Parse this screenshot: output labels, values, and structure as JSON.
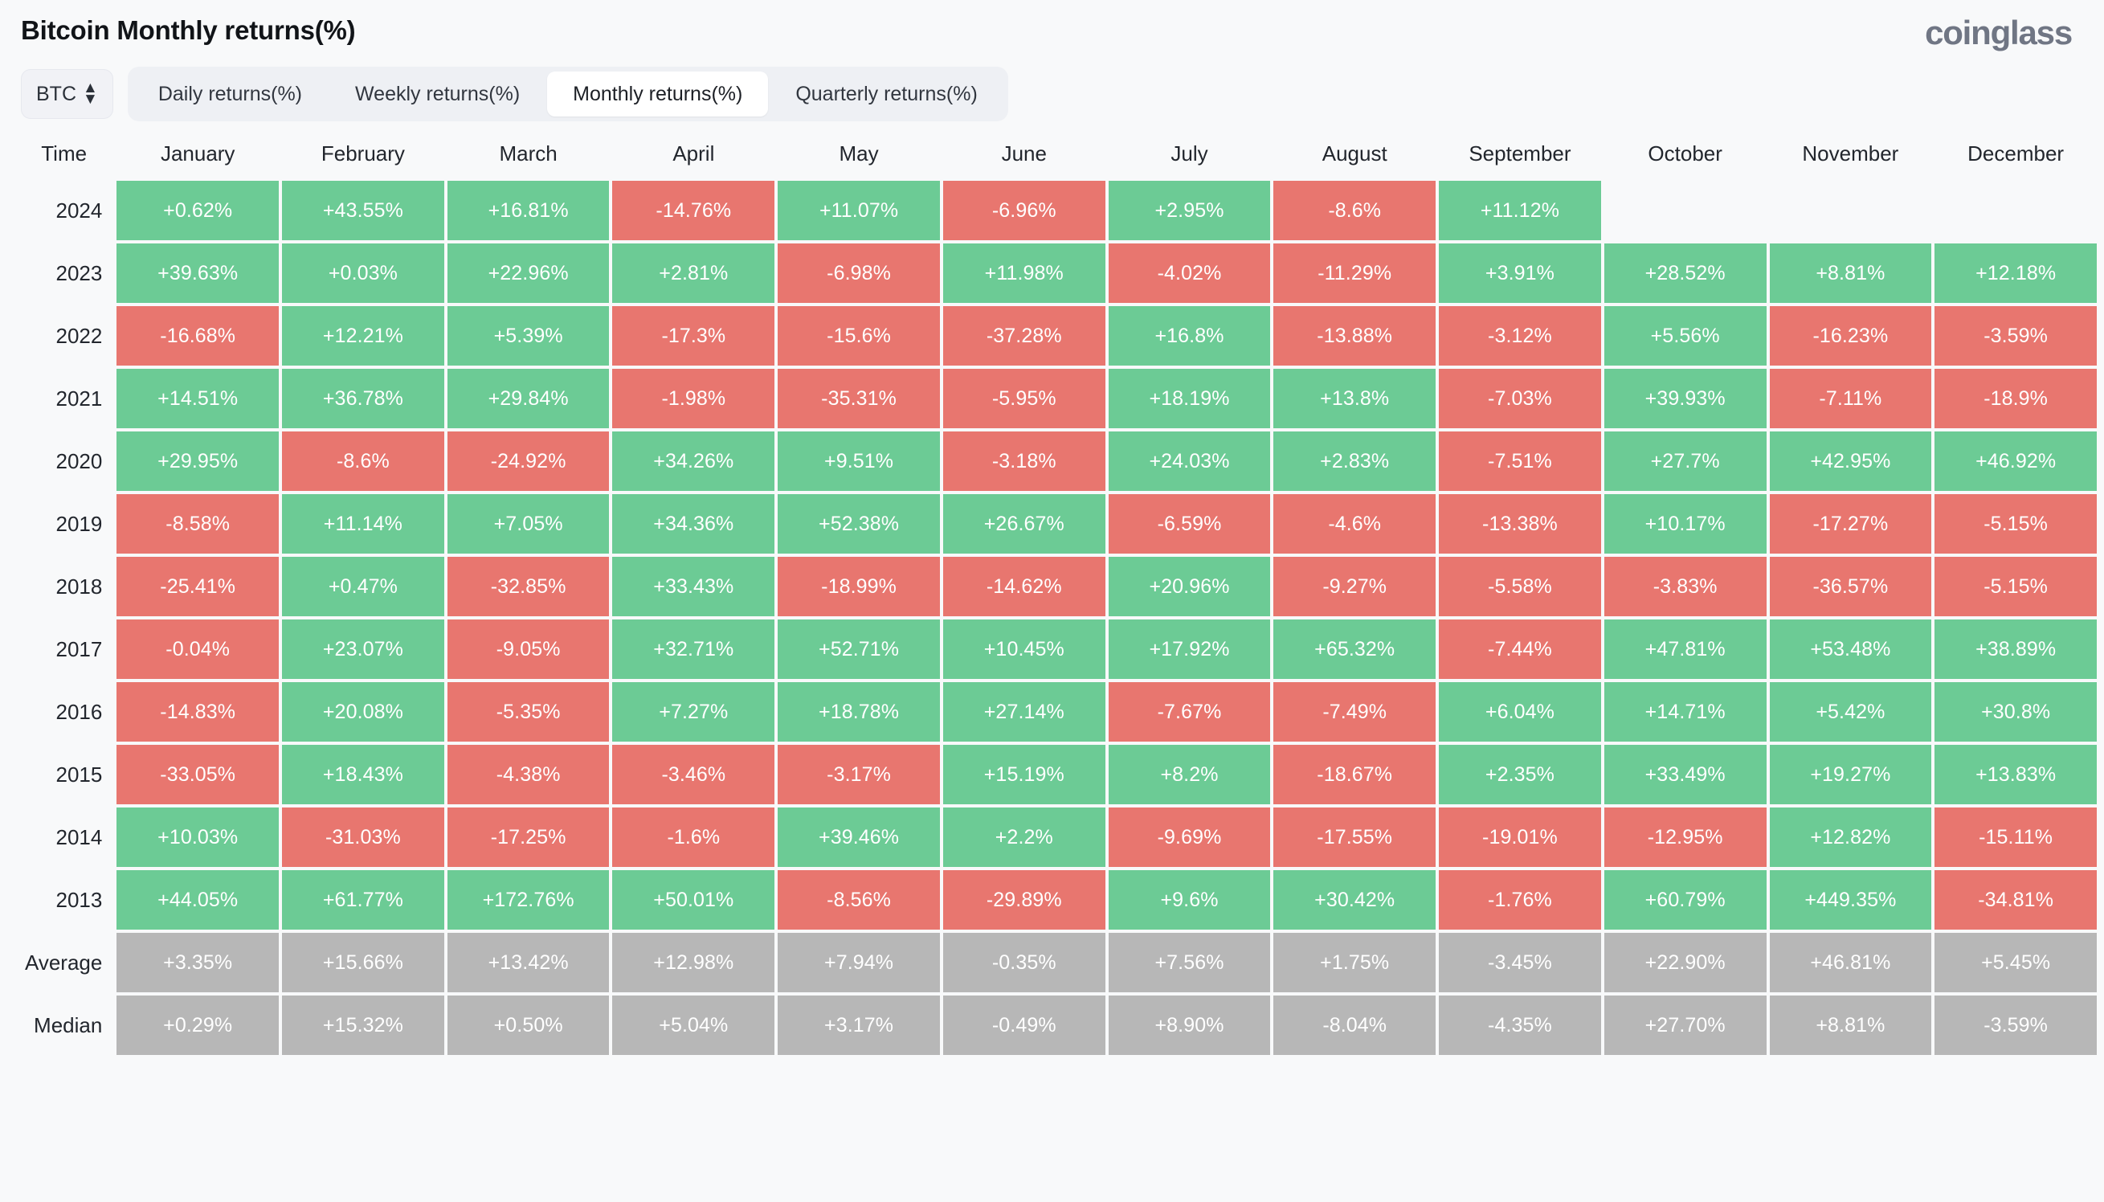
{
  "header": {
    "title": "Bitcoin Monthly returns(%)",
    "brand": "coinglass"
  },
  "controls": {
    "symbol": "BTC",
    "symbol_caret_icon": "chevron-updown-icon",
    "tabs": [
      {
        "label": "Daily returns(%)",
        "active": false
      },
      {
        "label": "Weekly returns(%)",
        "active": false
      },
      {
        "label": "Monthly returns(%)",
        "active": true
      },
      {
        "label": "Quarterly returns(%)",
        "active": false
      }
    ]
  },
  "colors": {
    "positive": "#6ccb95",
    "negative": "#e8766f",
    "neutral": "#b7b7b7",
    "background": "#f8f9fa",
    "brand": "#707684"
  },
  "chart_data": {
    "type": "heatmap",
    "title": "Bitcoin Monthly returns(%)",
    "xlabel": "",
    "ylabel": "Time",
    "time_header": "Time",
    "categories": [
      "January",
      "February",
      "March",
      "April",
      "May",
      "June",
      "July",
      "August",
      "September",
      "October",
      "November",
      "December"
    ],
    "rows": [
      {
        "label": "2024",
        "kind": "year",
        "values": [
          "+0.62%",
          "+43.55%",
          "+16.81%",
          "-14.76%",
          "+11.07%",
          "-6.96%",
          "+2.95%",
          "-8.6%",
          "+11.12%",
          "",
          "",
          ""
        ]
      },
      {
        "label": "2023",
        "kind": "year",
        "values": [
          "+39.63%",
          "+0.03%",
          "+22.96%",
          "+2.81%",
          "-6.98%",
          "+11.98%",
          "-4.02%",
          "-11.29%",
          "+3.91%",
          "+28.52%",
          "+8.81%",
          "+12.18%"
        ]
      },
      {
        "label": "2022",
        "kind": "year",
        "values": [
          "-16.68%",
          "+12.21%",
          "+5.39%",
          "-17.3%",
          "-15.6%",
          "-37.28%",
          "+16.8%",
          "-13.88%",
          "-3.12%",
          "+5.56%",
          "-16.23%",
          "-3.59%"
        ]
      },
      {
        "label": "2021",
        "kind": "year",
        "values": [
          "+14.51%",
          "+36.78%",
          "+29.84%",
          "-1.98%",
          "-35.31%",
          "-5.95%",
          "+18.19%",
          "+13.8%",
          "-7.03%",
          "+39.93%",
          "-7.11%",
          "-18.9%"
        ]
      },
      {
        "label": "2020",
        "kind": "year",
        "values": [
          "+29.95%",
          "-8.6%",
          "-24.92%",
          "+34.26%",
          "+9.51%",
          "-3.18%",
          "+24.03%",
          "+2.83%",
          "-7.51%",
          "+27.7%",
          "+42.95%",
          "+46.92%"
        ]
      },
      {
        "label": "2019",
        "kind": "year",
        "values": [
          "-8.58%",
          "+11.14%",
          "+7.05%",
          "+34.36%",
          "+52.38%",
          "+26.67%",
          "-6.59%",
          "-4.6%",
          "-13.38%",
          "+10.17%",
          "-17.27%",
          "-5.15%"
        ]
      },
      {
        "label": "2018",
        "kind": "year",
        "values": [
          "-25.41%",
          "+0.47%",
          "-32.85%",
          "+33.43%",
          "-18.99%",
          "-14.62%",
          "+20.96%",
          "-9.27%",
          "-5.58%",
          "-3.83%",
          "-36.57%",
          "-5.15%"
        ]
      },
      {
        "label": "2017",
        "kind": "year",
        "values": [
          "-0.04%",
          "+23.07%",
          "-9.05%",
          "+32.71%",
          "+52.71%",
          "+10.45%",
          "+17.92%",
          "+65.32%",
          "-7.44%",
          "+47.81%",
          "+53.48%",
          "+38.89%"
        ]
      },
      {
        "label": "2016",
        "kind": "year",
        "values": [
          "-14.83%",
          "+20.08%",
          "-5.35%",
          "+7.27%",
          "+18.78%",
          "+27.14%",
          "-7.67%",
          "-7.49%",
          "+6.04%",
          "+14.71%",
          "+5.42%",
          "+30.8%"
        ]
      },
      {
        "label": "2015",
        "kind": "year",
        "values": [
          "-33.05%",
          "+18.43%",
          "-4.38%",
          "-3.46%",
          "-3.17%",
          "+15.19%",
          "+8.2%",
          "-18.67%",
          "+2.35%",
          "+33.49%",
          "+19.27%",
          "+13.83%"
        ]
      },
      {
        "label": "2014",
        "kind": "year",
        "values": [
          "+10.03%",
          "-31.03%",
          "-17.25%",
          "-1.6%",
          "+39.46%",
          "+2.2%",
          "-9.69%",
          "-17.55%",
          "-19.01%",
          "-12.95%",
          "+12.82%",
          "-15.11%"
        ]
      },
      {
        "label": "2013",
        "kind": "year",
        "values": [
          "+44.05%",
          "+61.77%",
          "+172.76%",
          "+50.01%",
          "-8.56%",
          "-29.89%",
          "+9.6%",
          "+30.42%",
          "-1.76%",
          "+60.79%",
          "+449.35%",
          "-34.81%"
        ]
      },
      {
        "label": "Average",
        "kind": "summary",
        "values": [
          "+3.35%",
          "+15.66%",
          "+13.42%",
          "+12.98%",
          "+7.94%",
          "-0.35%",
          "+7.56%",
          "+1.75%",
          "-3.45%",
          "+22.90%",
          "+46.81%",
          "+5.45%"
        ]
      },
      {
        "label": "Median",
        "kind": "summary",
        "values": [
          "+0.29%",
          "+15.32%",
          "+0.50%",
          "+5.04%",
          "+3.17%",
          "-0.49%",
          "+8.90%",
          "-8.04%",
          "-4.35%",
          "+27.70%",
          "+8.81%",
          "-3.59%"
        ]
      }
    ]
  }
}
